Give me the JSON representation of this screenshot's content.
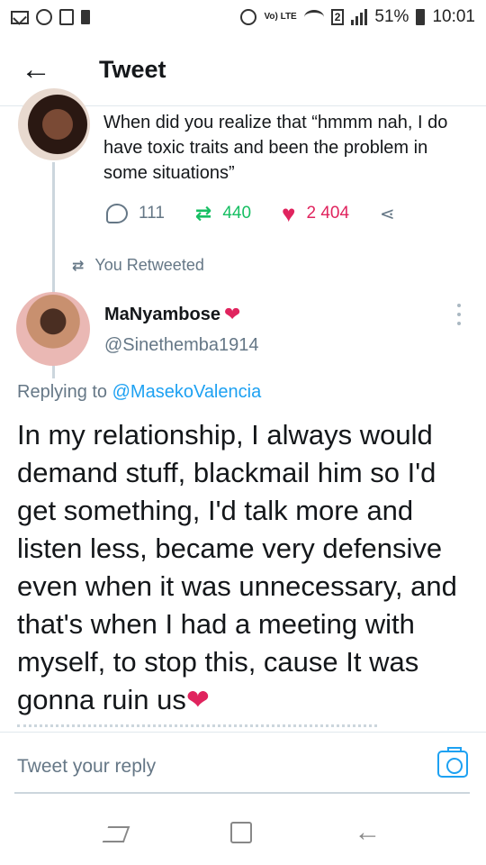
{
  "status_bar": {
    "volte": "Vo) LTE",
    "sim": "2",
    "battery": "51%",
    "time": "10:01"
  },
  "header": {
    "title": "Tweet"
  },
  "prev_tweet": {
    "text": "When did you realize that “hmmm nah, I do have toxic traits and been the problem in some situations”",
    "replies": "111",
    "retweets": "440",
    "likes": "2 404"
  },
  "retweet_label": "You Retweeted",
  "main_tweet": {
    "name": "MaNyambose",
    "handle": "@Sinethemba1914",
    "replying_prefix": "Replying to",
    "replying_handle": "@MasekoValencia",
    "text": "In my relationship, I always would demand stuff, blackmail him so I'd get something, I'd talk more and listen less, became very defensive even when it was unnecessary, and that's when I had a meeting with myself, to stop this, cause It was gonna ruin  us"
  },
  "reply_bar": {
    "placeholder": "Tweet your reply"
  },
  "colors": {
    "brand": "#1da1f2",
    "retweet": "#17bf63",
    "like": "#e0245e",
    "secondary_text": "#657786"
  },
  "icons": {
    "back": "arrow-left-icon",
    "reply": "reply-icon",
    "retweet": "retweet-icon",
    "like": "heart-icon",
    "share": "share-icon",
    "more": "more-vertical-icon",
    "camera": "camera-icon"
  }
}
